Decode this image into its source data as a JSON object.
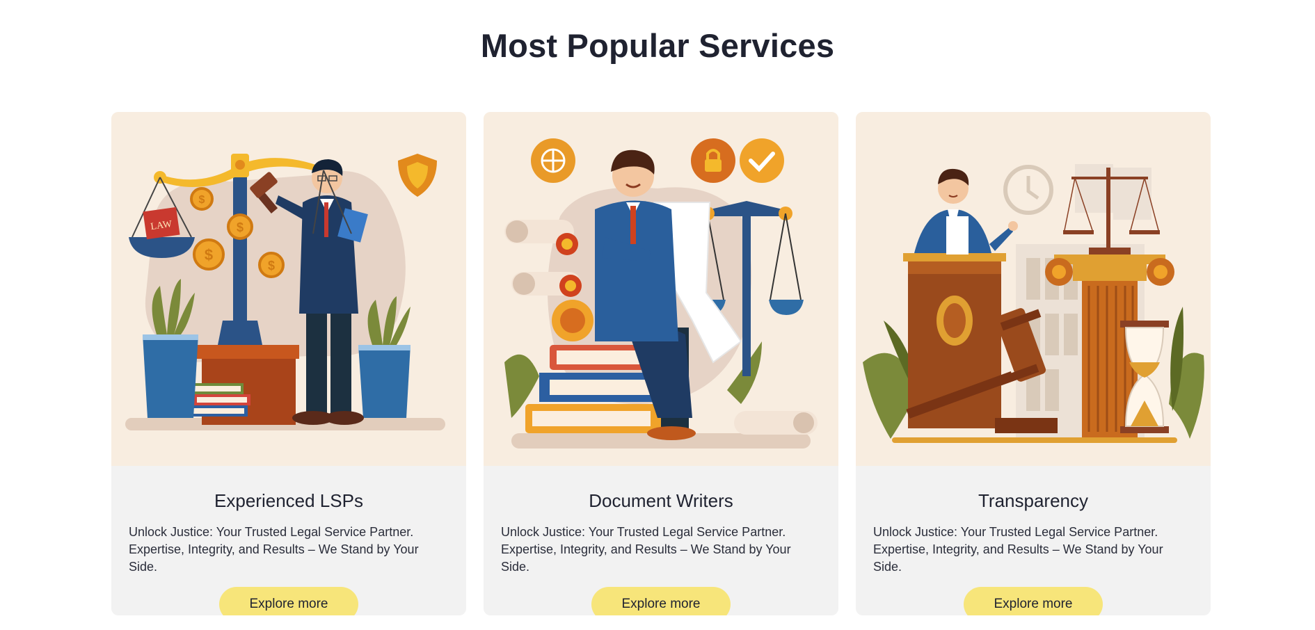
{
  "section": {
    "title": "Most Popular Services"
  },
  "cards": [
    {
      "title": "Experienced LSPs",
      "description": "Unlock Justice: Your Trusted Legal Service Partner. Expertise, Integrity, and Results – We Stand by Your Side.",
      "button_label": "Explore more",
      "illustration": "lawyer-with-scales-illustration",
      "book_label": "LAW"
    },
    {
      "title": "Document Writers",
      "description": "Unlock Justice: Your Trusted Legal Service Partner. Expertise, Integrity, and Results – We Stand by Your Side.",
      "button_label": "Explore more",
      "illustration": "document-writer-illustration"
    },
    {
      "title": "Transparency",
      "description": "Unlock Justice: Your Trusted Legal Service Partner. Expertise, Integrity, and Results – We Stand by Your Side.",
      "button_label": "Explore more",
      "illustration": "courtroom-judge-illustration"
    }
  ],
  "colors": {
    "illustration_bg": "#f8ede0",
    "card_body_bg": "#f2f2f2",
    "button_bg": "#f7e57a",
    "accent_orange": "#e09a2a",
    "accent_navy": "#22477a",
    "accent_brown": "#9a4a1c"
  }
}
